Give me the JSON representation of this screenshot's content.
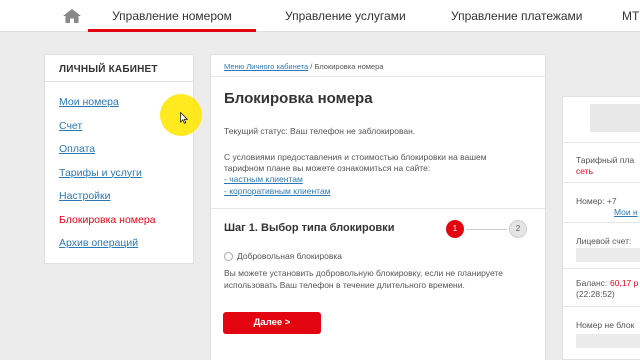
{
  "nav": {
    "tabs": [
      {
        "label": "Управление номером",
        "active": true
      },
      {
        "label": "Управление услугами",
        "active": false
      },
      {
        "label": "Управление платежами",
        "active": false
      },
      {
        "label": "МТС",
        "active": false
      }
    ]
  },
  "sidebar": {
    "title": "ЛИЧНЫЙ КАБИНЕТ",
    "items": [
      {
        "label": "Мои номера",
        "active": false
      },
      {
        "label": "Счет",
        "active": false
      },
      {
        "label": "Оплата",
        "active": false
      },
      {
        "label": "Тарифы и услуги",
        "active": false
      },
      {
        "label": "Настройки",
        "active": false
      },
      {
        "label": "Блокировка номера",
        "active": true
      },
      {
        "label": "Архив операций",
        "active": false
      }
    ]
  },
  "breadcrumb": {
    "link": "Меню Личного кабинета",
    "separator": "/",
    "current": "Блокировка номера"
  },
  "main": {
    "title": "Блокировка номера",
    "status": "Текущий статус: Ваш телефон не заблокирован.",
    "conditions_line1": "С условиями предоставления и стоимостью блокировки на вашем",
    "conditions_line2": "тарифном плане вы можете ознакомиться на сайте:",
    "link_private": "- частным клиентам",
    "link_corporate": "- корпоративным клиентам",
    "step_title": "Шаг 1. Выбор типа блокировки",
    "step_current": "1",
    "step_next": "2",
    "radio_label": "Добровольная блокировка",
    "radio_desc_line1": "Вы можете установить добровольную блокировку, если не планируете",
    "radio_desc_line2": "использовать Ваш телефон в течение длительного времени.",
    "next_button": "Далее >"
  },
  "right_panel": {
    "tariff_label": "Тарифный пла",
    "tariff_value": "сеть",
    "number_label": "Номер: +7",
    "number_link": "Мои н",
    "account_label": "Лицевой счет:",
    "balance_label": "Баланс:",
    "balance_value": "60,17 р",
    "balance_time": "(22:28:52)",
    "not_blocked": "Номер не блок"
  },
  "colors": {
    "accent": "#e30611",
    "link": "#2d79b8",
    "background": "#ececec",
    "highlight": "#ffe600"
  },
  "icons": {
    "home": "home-icon",
    "cursor": "mouse-pointer-icon"
  }
}
